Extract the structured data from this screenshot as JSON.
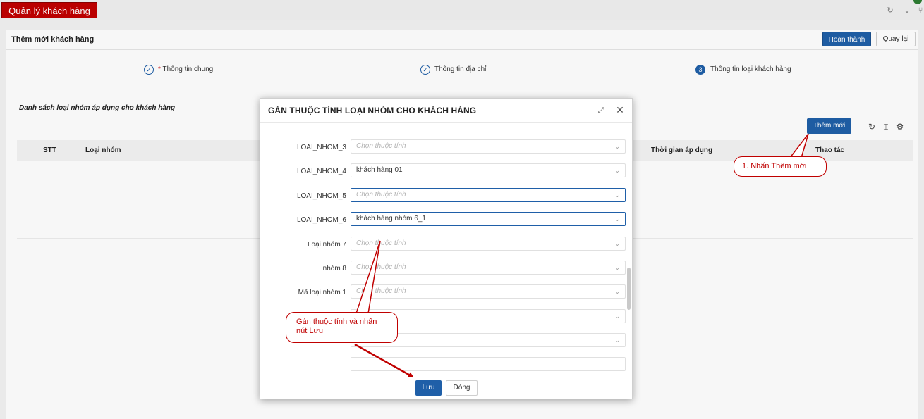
{
  "app": {
    "title": "Quản lý khách hàng"
  },
  "page": {
    "title": "Thêm mới khách hàng",
    "complete_label": "Hoàn thành",
    "back_label": "Quay lại"
  },
  "steps": [
    {
      "number": "1",
      "required_mark": "*",
      "label": "Thông tin chung",
      "status": "done"
    },
    {
      "number": "2",
      "label": "Thông tin địa chỉ",
      "status": "done"
    },
    {
      "number": "3",
      "label": "Thông tin loại khách hàng",
      "status": "active"
    }
  ],
  "list": {
    "title": "Danh sách loại nhóm áp dụng cho khách hàng",
    "add_label": "Thêm mới",
    "columns": {
      "stt": "STT",
      "group_type": "Loại nhóm",
      "apply_time": "Thời gian áp dụng",
      "actions": "Thao tác"
    }
  },
  "modal": {
    "title": "GÁN THUỘC TÍNH LOẠI NHÓM CHO KHÁCH HÀNG",
    "fields": [
      {
        "label": "LOAI_NHOM_3",
        "value": "",
        "placeholder": "Chọn thuộc tính"
      },
      {
        "label": "LOAI_NHOM_4",
        "value": "khách hàng 01",
        "placeholder": "Chọn thuộc tính"
      },
      {
        "label": "LOAI_NHOM_5",
        "value": "",
        "placeholder": "Chọn thuộc tính"
      },
      {
        "label": "LOAI_NHOM_6",
        "value": "khách hàng nhóm 6_1",
        "placeholder": "Chọn thuộc tính"
      },
      {
        "label": "Loại nhóm 7",
        "value": "",
        "placeholder": "Chọn thuộc tính"
      },
      {
        "label": "nhóm 8",
        "value": "",
        "placeholder": "Chọn thuộc tính"
      },
      {
        "label": "Mã loại nhóm 1",
        "value": "",
        "placeholder": "Chọn thuộc tính"
      }
    ],
    "save_label": "Lưu",
    "close_label": "Đóng"
  },
  "callouts": {
    "step1": "1. Nhấn Thêm mới",
    "step2_line1": "Gán thuộc tính và nhấn",
    "step2_line2": "nút Lưu"
  },
  "colors": {
    "brand_red": "#c00000",
    "primary_blue": "#1f5fa8"
  },
  "icons": {
    "refresh": "refresh-icon",
    "column_height": "column-height-icon",
    "settings": "gear-icon",
    "expand": "expand-icon",
    "close": "close-icon",
    "chevron": "chevron-down-icon",
    "check": "check-circle-icon"
  }
}
